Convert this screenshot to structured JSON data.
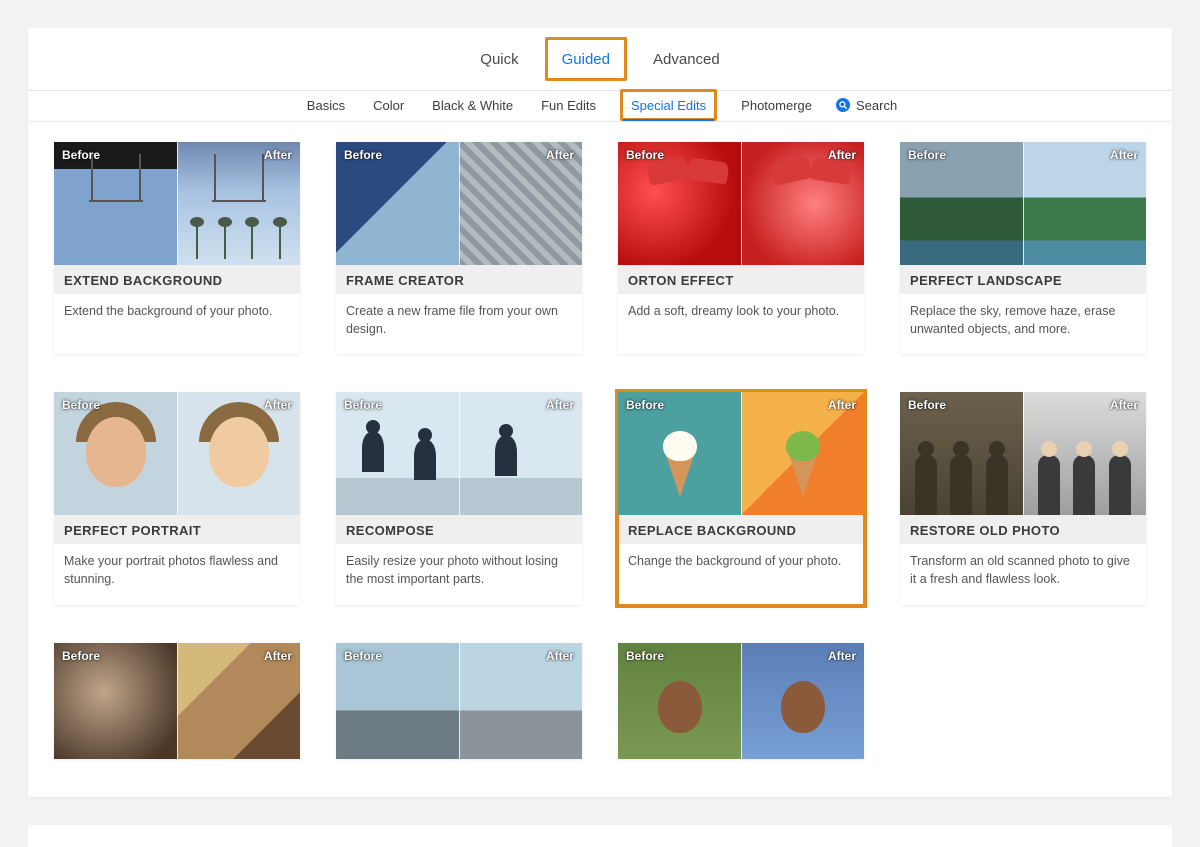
{
  "modeTabs": {
    "items": [
      {
        "label": "Quick",
        "active": false,
        "highlight": false
      },
      {
        "label": "Guided",
        "active": true,
        "highlight": true
      },
      {
        "label": "Advanced",
        "active": false,
        "highlight": false
      }
    ]
  },
  "subTabs": {
    "items": [
      {
        "label": "Basics"
      },
      {
        "label": "Color"
      },
      {
        "label": "Black & White"
      },
      {
        "label": "Fun Edits"
      },
      {
        "label": "Special Edits",
        "active": true,
        "highlight": true
      },
      {
        "label": "Photomerge"
      }
    ],
    "searchLabel": "Search"
  },
  "thumbLabels": {
    "before": "Before",
    "after": "After"
  },
  "cards": [
    {
      "id": "extend-background",
      "title": "EXTEND BACKGROUND",
      "desc": "Extend the background of your photo."
    },
    {
      "id": "frame-creator",
      "title": "FRAME CREATOR",
      "desc": "Create a new frame file from your own design."
    },
    {
      "id": "orton-effect",
      "title": "ORTON EFFECT",
      "desc": "Add a soft, dreamy look to your photo."
    },
    {
      "id": "perfect-landscape",
      "title": "PERFECT LANDSCAPE",
      "desc": "Replace the sky, remove haze, erase unwanted objects, and more."
    },
    {
      "id": "perfect-portrait",
      "title": "PERFECT PORTRAIT",
      "desc": "Make your portrait photos flawless and stunning."
    },
    {
      "id": "recompose",
      "title": "RECOMPOSE",
      "desc": "Easily resize your photo without losing the most important parts."
    },
    {
      "id": "replace-background",
      "title": "REPLACE BACKGROUND",
      "desc": "Change the background of your photo.",
      "highlight": true
    },
    {
      "id": "restore-old-photo",
      "title": "RESTORE OLD PHOTO",
      "desc": "Transform an old scanned photo to give it a fresh and flawless look."
    }
  ],
  "row3": [
    "card-row3-a",
    "card-row3-b",
    "card-row3-c"
  ]
}
